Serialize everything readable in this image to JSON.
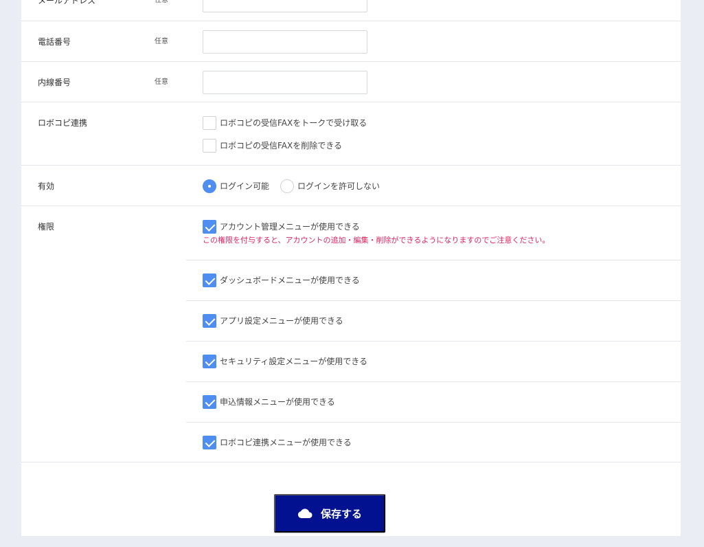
{
  "form": {
    "email": {
      "label": "メールアドレス",
      "badge": "任意",
      "value": "",
      "placeholder": ""
    },
    "phone": {
      "label": "電話番号",
      "badge": "任意",
      "value": "",
      "placeholder": ""
    },
    "extension": {
      "label": "内線番号",
      "badge": "任意",
      "value": "",
      "placeholder": ""
    },
    "robocopy": {
      "label": "ロボコピ連携",
      "options": [
        {
          "label": "ロボコピの受信FAXをトークで受け取る",
          "checked": false
        },
        {
          "label": "ロボコピの受信FAXを削除できる",
          "checked": false
        }
      ]
    },
    "enabled": {
      "label": "有効",
      "options": [
        {
          "label": "ログイン可能",
          "selected": true
        },
        {
          "label": "ログインを許可しない",
          "selected": false
        }
      ]
    },
    "permissions": {
      "label": "権限",
      "warning": "この権限を付与すると、アカウントの追加・編集・削除ができるようになりますのでご注意ください。",
      "items": [
        {
          "label": "アカウント管理メニューが使用できる",
          "checked": true
        },
        {
          "label": "ダッシュボードメニューが使用できる",
          "checked": true
        },
        {
          "label": "アプリ設定メニューが使用できる",
          "checked": true
        },
        {
          "label": "セキュリティ設定メニューが使用できる",
          "checked": true
        },
        {
          "label": "申込情報メニューが使用できる",
          "checked": true
        },
        {
          "label": "ロボコピ連携メニューが使用できる",
          "checked": true
        }
      ]
    }
  },
  "save_button": {
    "label": "保存する",
    "icon": "cloud-icon",
    "color": "#021190"
  },
  "colors": {
    "checkbox_checked": "#4f8ef0",
    "warning_text": "#e0245e",
    "background": "#eaedf4"
  }
}
